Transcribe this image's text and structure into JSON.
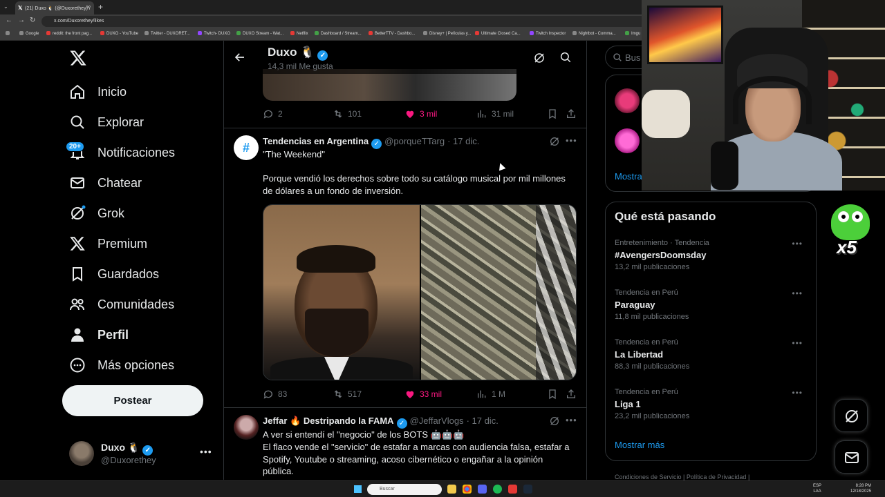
{
  "browser": {
    "tab_title": "(21) Duxo 🐧 (@Duxorethey) /",
    "url": "x.com/Duxorethey/likes",
    "bookmarks": [
      "Google",
      "reddit: the front pag...",
      "DUXO - YouTube",
      "Twitter - DUXORET...",
      "Twitch- DUXO",
      "DUXO Stream - Wat...",
      "Netflix",
      "Dashboard / Stream...",
      "BetterTTV - Dashbo...",
      "Disney+ | Películas y...",
      "Ultimate Closed Ca...",
      "Twitch Inspector",
      "Nightbot - Comma...",
      "Imgu"
    ]
  },
  "nav": {
    "items": [
      {
        "label": "Inicio",
        "icon": "home-icon"
      },
      {
        "label": "Explorar",
        "icon": "search-icon"
      },
      {
        "label": "Notificaciones",
        "icon": "bell-icon"
      },
      {
        "label": "Chatear",
        "icon": "mail-icon"
      },
      {
        "label": "Grok",
        "icon": "grok-icon"
      },
      {
        "label": "Premium",
        "icon": "x-icon"
      },
      {
        "label": "Guardados",
        "icon": "bookmark-icon"
      },
      {
        "label": "Comunidades",
        "icon": "people-icon"
      },
      {
        "label": "Perfil",
        "icon": "person-icon"
      },
      {
        "label": "Más opciones",
        "icon": "more-circle-icon"
      }
    ],
    "notification_badge": "20+",
    "post_button": "Postear",
    "account": {
      "name": "Duxo 🐧",
      "handle": "@Duxorethey"
    }
  },
  "header": {
    "name": "Duxo 🐧",
    "subtitle": "14,3 mil Me gusta"
  },
  "prev_tweet": {
    "replies": "2",
    "reposts": "101",
    "likes": "3 mil",
    "views": "31 mil"
  },
  "tweet1": {
    "name": "Tendencias en Argentina",
    "handle": "@porqueTTarg",
    "date": "· 17 dic.",
    "line1": "\"The Weekend\"",
    "line2": "Porque vendió los derechos sobre todo su catálogo musical por mil millones de dólares a un fondo de inversión.",
    "replies": "83",
    "reposts": "517",
    "likes": "33 mil",
    "views": "1 M"
  },
  "tweet2": {
    "name": "Jeffar 🔥 Destripando la FAMA",
    "handle": "@JeffarVlogs",
    "date": "· 17 dic.",
    "line1": "A ver si entendí el \"negocio\" de los BOTS 🤖🤖🤖",
    "line2": "El flaco vende el \"servicio\" de estafar a marcas con audiencia falsa, estafar a Spotify, Youtube o streaming, acoso cibernético o engañar a la opinión pública."
  },
  "right": {
    "search_placeholder": "Bus",
    "who_to_follow_more": "Mostra",
    "trends_title": "Qué está pasando",
    "trends": [
      {
        "context": "Entretenimiento · Tendencia",
        "name": "#AvengersDoomsday",
        "count": "13,2 mil publicaciones"
      },
      {
        "context": "Tendencia en Perú",
        "name": "Paraguay",
        "count": "11,8 mil publicaciones"
      },
      {
        "context": "Tendencia en Perú",
        "name": "La Libertad",
        "count": "88,3 mil publicaciones"
      },
      {
        "context": "Tendencia en Perú",
        "name": "Liga 1",
        "count": "23,2 mil publicaciones"
      }
    ],
    "trends_more": "Mostrar más",
    "footer": "Condiciones de Servicio   |   Política de Privacidad   |"
  },
  "overlay": {
    "emote_count": "x5"
  },
  "taskbar": {
    "search": "Buscar",
    "lang_top": "ESP",
    "lang_bottom": "LAA",
    "time": "8:28 PM",
    "date": "12/18/2025"
  },
  "colors": {
    "accent": "#1d9bf0",
    "like": "#f91880",
    "border": "#2f3336",
    "muted": "#71767b"
  }
}
